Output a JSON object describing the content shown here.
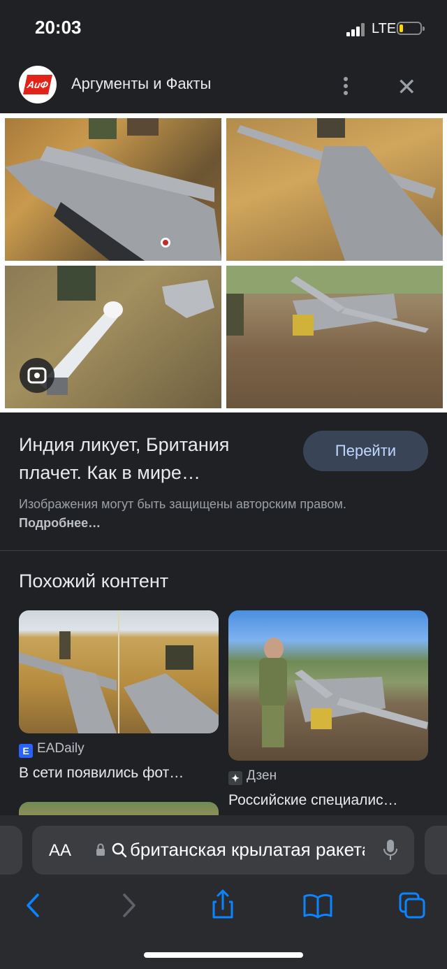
{
  "status_bar": {
    "time": "20:03",
    "network": "LTE"
  },
  "source": {
    "logo_text": "АиФ",
    "title": "Аргументы и Факты"
  },
  "result": {
    "title": "Индия ликует, Британия плачет. Как в мире…",
    "goto_label": "Перейти",
    "copyright_text": "Изображения могут быть защищены авторским правом.",
    "copyright_more": "Подробнее…"
  },
  "similar": {
    "heading": "Похожий контент",
    "cards": [
      {
        "source": "EADaily",
        "source_icon": "E",
        "title": "В сети появились фот…"
      },
      {
        "source": "Дзен",
        "source_icon": "✦",
        "title": "Российские специалис…"
      }
    ]
  },
  "browser": {
    "aa_label": "AA",
    "query": "британская крылатая ракета"
  },
  "colors": {
    "background": "#202124",
    "button_bg": "#394457",
    "button_text": "#c2d7ff",
    "accent_blue": "#0a84ff",
    "brand_red": "#e2231a"
  }
}
